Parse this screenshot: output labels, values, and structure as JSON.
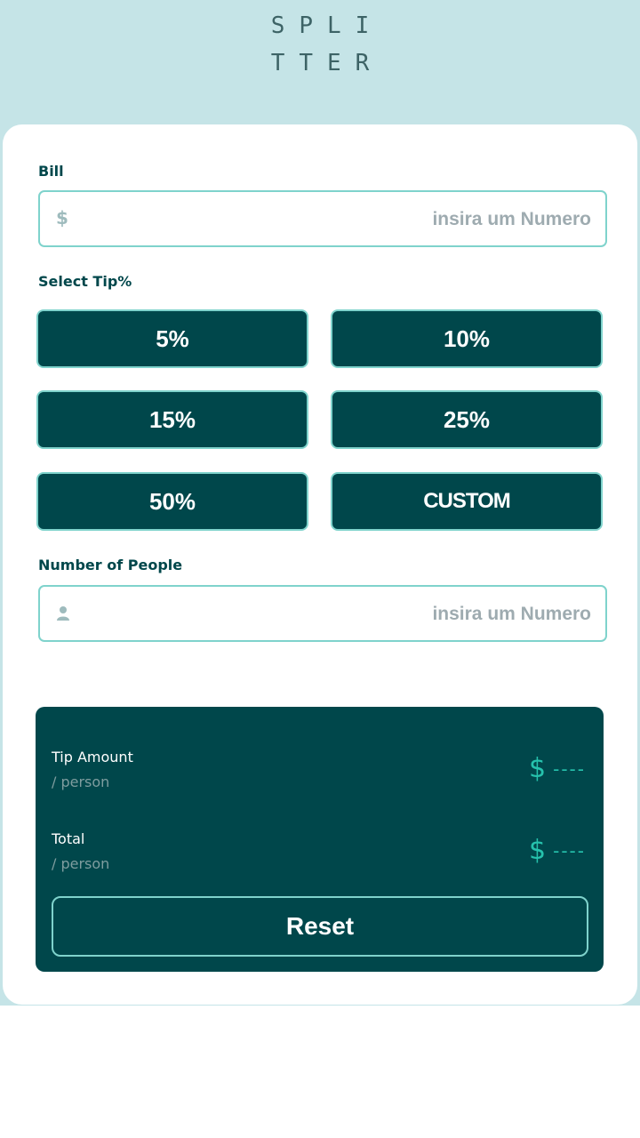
{
  "logo": {
    "line1": "SPLI",
    "line2": "TTER"
  },
  "bill": {
    "label": "Bill",
    "icon": "dollar-icon",
    "icon_glyph": "$",
    "value": "",
    "placeholder": "insira um Numero"
  },
  "tip": {
    "label": "Select Tip%",
    "options": [
      "5%",
      "10%",
      "15%",
      "25%",
      "50%",
      "CUSTOM"
    ]
  },
  "people": {
    "label": "Number of People",
    "icon": "person-icon",
    "value": "",
    "placeholder": "insira um Numero"
  },
  "results": {
    "tip_amount": {
      "title": "Tip Amount",
      "sub": "/ person",
      "currency": "$",
      "value": "----"
    },
    "total": {
      "title": "Total",
      "sub": "/ person",
      "currency": "$",
      "value": "----"
    },
    "reset_label": "Reset"
  },
  "colors": {
    "background": "#c5e4e7",
    "dark_cyan": "#00474b",
    "accent": "#26c2ad",
    "border": "#7fd3cc"
  }
}
